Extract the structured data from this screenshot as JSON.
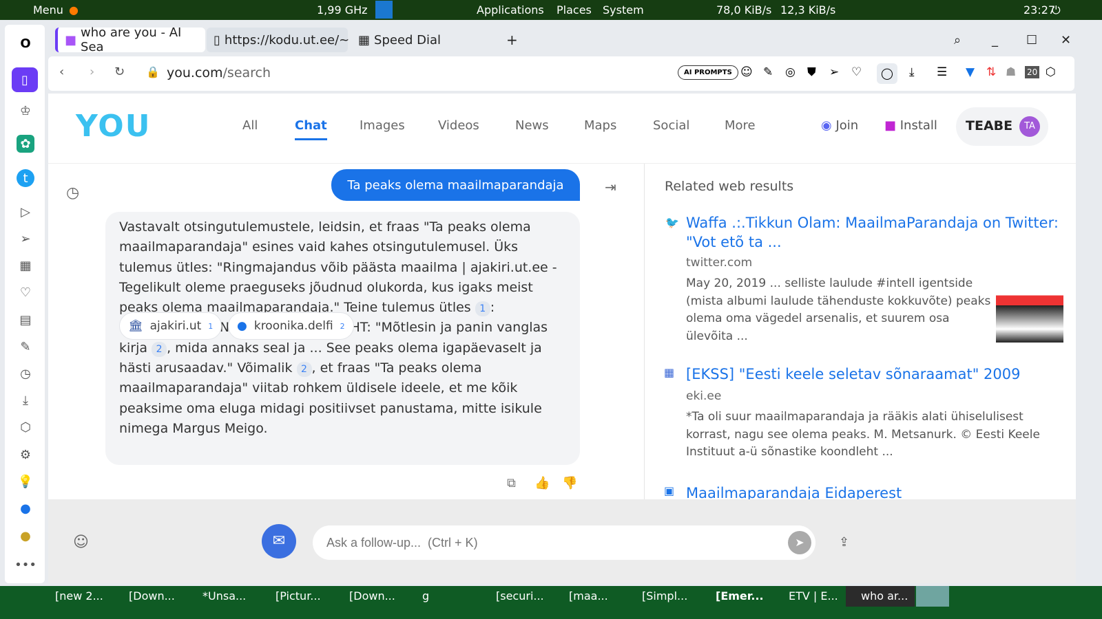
{
  "system_bar": {
    "menu": "Menu",
    "cpu": "1,99 GHz",
    "applications": "Applications",
    "places": "Places",
    "system": "System",
    "net_down": "78,0 KiB/s",
    "net_up": "12,3 KiB/s",
    "clock": "23:27"
  },
  "browser": {
    "tabs": [
      {
        "label": "who are you - AI Sea"
      },
      {
        "label": "https://kodu.ut.ee/~"
      },
      {
        "label": "Speed Dial"
      }
    ],
    "url_host": "you.com",
    "url_path": "/search",
    "ai_prompts": "AI PROMPTS",
    "badge_20": "20"
  },
  "site": {
    "logo": "YOU",
    "nav": [
      "All",
      "Chat",
      "Images",
      "Videos",
      "News",
      "Maps",
      "Social",
      "More"
    ],
    "join": "Join",
    "install": "Install",
    "user": "TEABE",
    "avatar": "TA"
  },
  "chat": {
    "query": "Ta peaks olema maailmaparandaja",
    "answer": {
      "p1": "Vastavalt otsingutulemustele, leidsin, et fraas \"Ta peaks olema maailmaparandaja\" esines vaid kahes otsingutulemusel. Üks tulemus ütles: \"Ringmajandus võib päästa maailma | ajakiri.ut.ee - Tegelikult oleme praeguseks jõudnud olukorda, kus igaks meist peaks olema maailmaparandaja.\" Teine tulemus ütles ",
      "c1": "1",
      "p2": ": \"MAAILMAPARANDAJA KERSTI KRACHT: \"Mõtlesin ja panin vanglas kirja ",
      "c2": "2",
      "p3": ", mida annaks seal ja ... See peaks olema igapäevaselt ja hästi arusaadav.\" Võimalik ",
      "c3": "2",
      "p4": ", et fraas \"Ta peaks olema maailmaparandaja\" viitab rohkem üldisele ideele, et me kõik peaksime oma eluga midagi positiivset panustama, mitte isikule nimega Margus Meigo."
    },
    "sources": [
      {
        "name": "ajakiri.ut",
        "num": "1"
      },
      {
        "name": "kroonika.delfi",
        "num": "2"
      }
    ],
    "input_placeholder": "Ask a follow-up...  (Ctrl + K)"
  },
  "related": {
    "heading": "Related web results",
    "items": [
      {
        "title": "Waffa .:.Tikkun Olam: MaailmaParandaja on Twitter: \"Vot etõ ta ...",
        "domain": "twitter.com",
        "snippet": "May 20, 2019 ... selliste laulude #intell igentside (mista albumi laulude tähenduste kokkuvõte) peaks olema oma vägedel arsenalis, et suurem osa ülevõita ..."
      },
      {
        "title": "[EKSS] \"Eesti keele seletav sõnaraamat\" 2009",
        "domain": "eki.ee",
        "snippet": "*Ta oli suur maailmaparandaja ja rääkis alati ühiselulisest korrast, nagu see olema peaks. M. Metsanurk. © Eesti Keele Instituut a-ü sõnastike koondleht ..."
      },
      {
        "title": "Maailmaparandaja Eidaperest"
      }
    ]
  },
  "taskbar": [
    "[new 2...",
    "[Down...",
    "*Unsa...",
    "[Pictur...",
    "[Down...",
    "g",
    "[securi...",
    "[maa...",
    "[Simpl...",
    "[Emer...",
    "ETV | E...",
    "who ar..."
  ]
}
